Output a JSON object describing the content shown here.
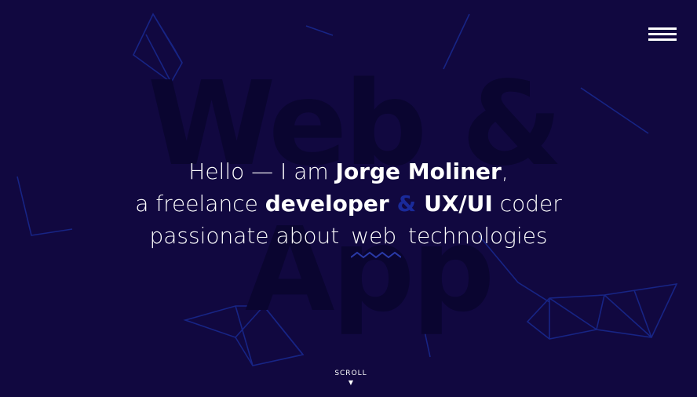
{
  "background": {
    "color": "#110840",
    "watermark_line1": "Web &",
    "watermark_line2": "App",
    "wire_color": "#1a2e9c"
  },
  "header": {
    "menu_icon": "hamburger-menu-icon"
  },
  "intro": {
    "line1": {
      "prefix": "Hello — I am ",
      "name": "Jorge Moliner",
      "suffix": ","
    },
    "line2": {
      "prefix": "a freelance ",
      "role1": "developer",
      "ampersand": "&",
      "role2": "UX/UI",
      "suffix": " coder"
    },
    "line3": {
      "prefix": "passionate about ",
      "highlight": "web",
      "suffix": " technologies"
    },
    "accent_color": "#1a2a9a"
  },
  "scroll": {
    "label": "SCROLL",
    "arrow": "▼"
  }
}
